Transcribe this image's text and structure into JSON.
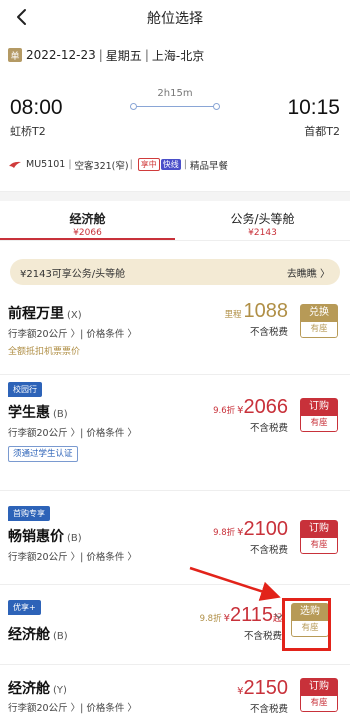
{
  "header": {
    "title": "舱位选择"
  },
  "route": {
    "tag": "单",
    "date": "2022-12-23",
    "weekday": "星期五",
    "cities": "上海-北京"
  },
  "flight": {
    "dep_time": "08:00",
    "dep_airport": "虹桥T2",
    "arr_time": "10:15",
    "arr_airport": "首都T2",
    "duration": "2h15m",
    "number": "MU5101",
    "aircraft": "空客321(窄)",
    "tag_share": "享中",
    "tag_fast": "快线",
    "meal": "精品早餐"
  },
  "tabs": [
    {
      "label": "经济舱",
      "price": "¥2066",
      "active": true
    },
    {
      "label": "公务/头等舱",
      "price": "¥2143",
      "active": false
    }
  ],
  "promo": {
    "text": "¥2143可享公务/头等舱",
    "link": "去瞧瞧 〉"
  },
  "fares": [
    {
      "badge": "",
      "name": "前程万里",
      "code": "(X)",
      "sub": "行李额20公斤 〉| 价格条件 〉",
      "extra": "全额抵扣机票票价",
      "discount": "里程",
      "currency": "",
      "price": "1088",
      "suffix": "",
      "tax": "不含税费",
      "btn_top": "兑换",
      "btn_bot": "有座",
      "btn_style": "gold"
    },
    {
      "badge": "校园行",
      "name": "学生惠",
      "code": "(B)",
      "sub": "行李额20公斤 〉| 价格条件 〉",
      "extra": "须通过学生认证",
      "discount": "9.6折",
      "currency": "¥",
      "price": "2066",
      "suffix": "",
      "tax": "不含税费",
      "btn_top": "订购",
      "btn_bot": "有座",
      "btn_style": "red"
    },
    {
      "badge": "首购专享",
      "name": "畅销惠价",
      "code": "(B)",
      "sub": "行李额20公斤 〉| 价格条件 〉",
      "extra": "",
      "discount": "9.8折",
      "currency": "¥",
      "price": "2100",
      "suffix": "",
      "tax": "不含税费",
      "btn_top": "订购",
      "btn_bot": "有座",
      "btn_style": "red"
    },
    {
      "badge": "优享+",
      "name": "经济舱",
      "code": "(B)",
      "sub": "",
      "extra": "",
      "discount": "9.8折",
      "currency": "¥",
      "price": "2115",
      "suffix": "起",
      "tax": "不含税费",
      "btn_top": "选购",
      "btn_bot": "有座",
      "btn_style": "gold"
    },
    {
      "badge": "",
      "name": "经济舱",
      "code": "(Y)",
      "sub": "行李额20公斤 〉| 价格条件 〉",
      "extra": "",
      "discount": "",
      "currency": "¥",
      "price": "2150",
      "suffix": "",
      "tax": "不含税费",
      "btn_top": "订购",
      "btn_bot": "有座",
      "btn_style": "red"
    }
  ],
  "colors": {
    "accent_red": "#c8313a",
    "gold": "#b79a57",
    "blue_badge": "#2d63b8",
    "annotation": "#e2231a"
  }
}
